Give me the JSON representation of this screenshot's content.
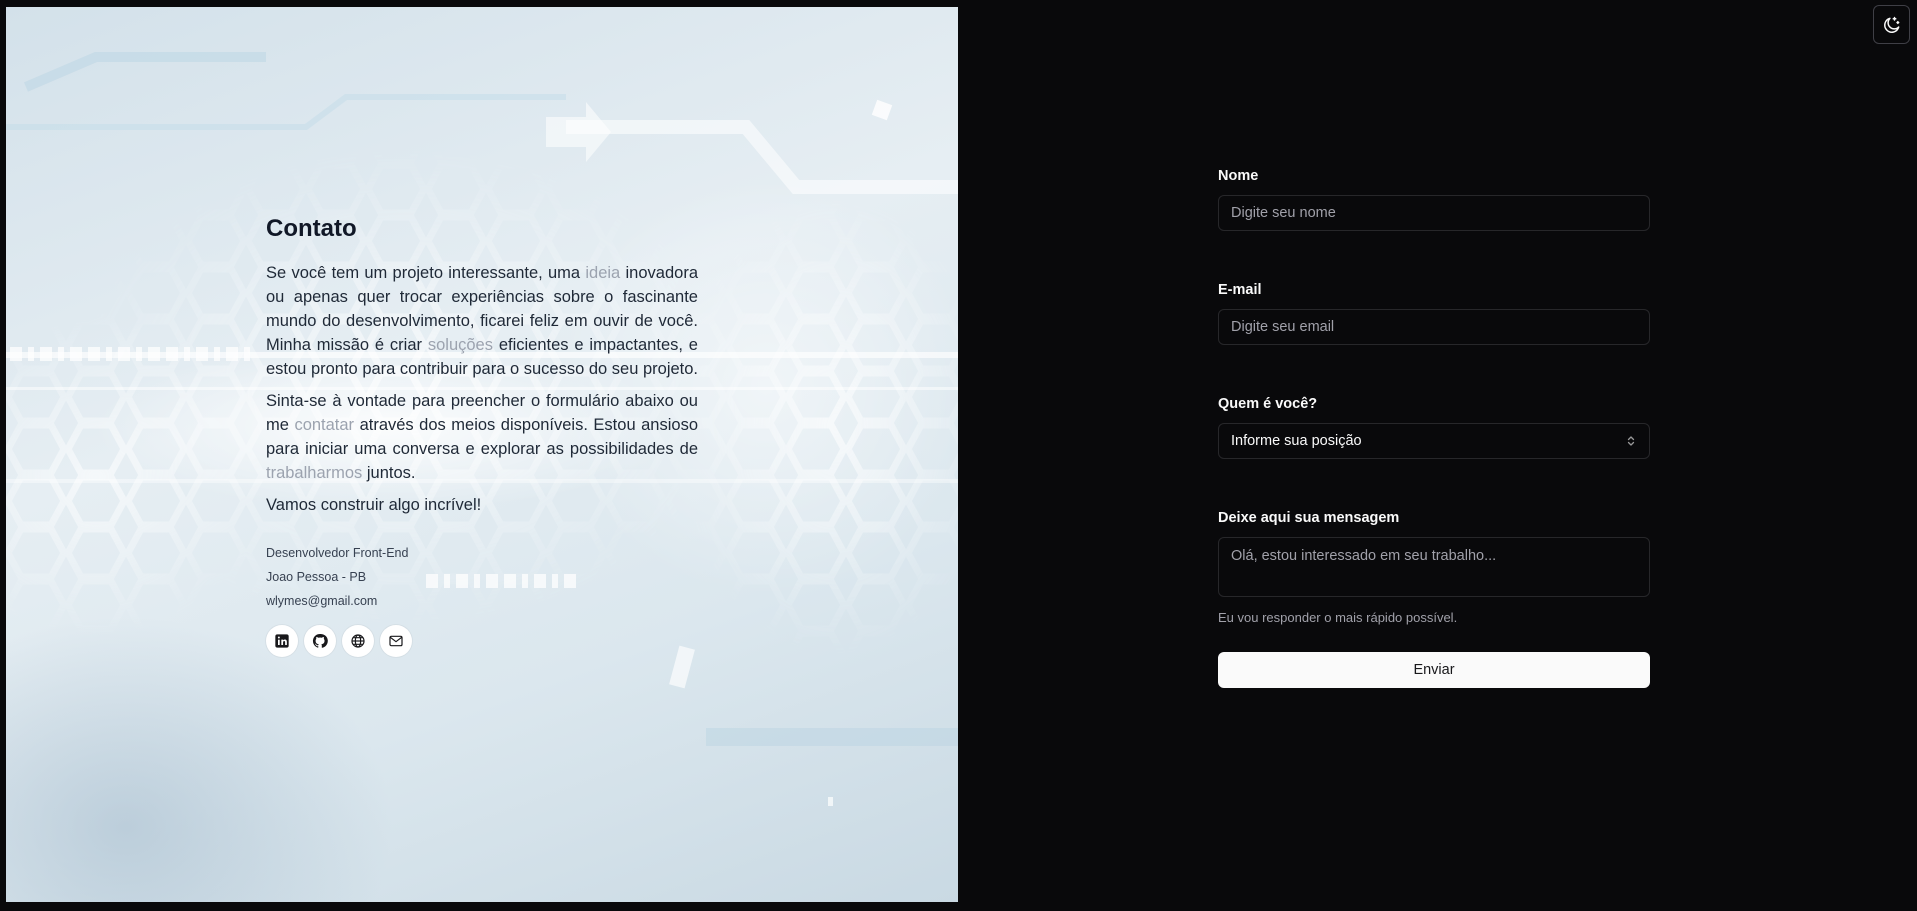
{
  "contact": {
    "title": "Contato",
    "para1": [
      "Se você tem um projeto interessante, uma ",
      "ideia",
      " inovadora ou apenas quer trocar experiências sobre o fascinante mundo do desenvolvimento, ficarei feliz em ouvir de você. Minha missão é criar ",
      "soluções",
      " eficientes e impactantes, e estou pronto para contribuir para o sucesso do seu projeto."
    ],
    "para2": [
      "Sinta-se à vontade para preencher o formulário abaixo ou me ",
      "contatar",
      " através dos meios disponíveis. Estou ansioso para iniciar uma conversa e explorar as possibilidades de ",
      "trabalharmos",
      " juntos."
    ],
    "para3": "Vamos construir algo incrível!",
    "role": "Desenvolvedor Front-End",
    "location": "Joao Pessoa - PB",
    "email": "wlymes@gmail.com",
    "highlight_color": "#9ca3af",
    "social": [
      "linkedin-icon",
      "github-icon",
      "globe-icon",
      "mail-icon"
    ]
  },
  "form": {
    "name_label": "Nome",
    "name_placeholder": "Digite seu nome",
    "email_label": "E-mail",
    "email_placeholder": "Digite seu email",
    "role_label": "Quem é você?",
    "role_value": "Informe sua posição",
    "message_label": "Deixe aqui sua mensagem",
    "message_placeholder": "Olá, estou interessado em seu trabalho...",
    "hint": "Eu vou responder o mais rápido possível.",
    "submit_label": "Enviar"
  },
  "theme": {
    "toggle_icon": "moon-sparkles-icon",
    "background": "#09090b",
    "foreground": "#fafafa",
    "border": "#27272a"
  }
}
